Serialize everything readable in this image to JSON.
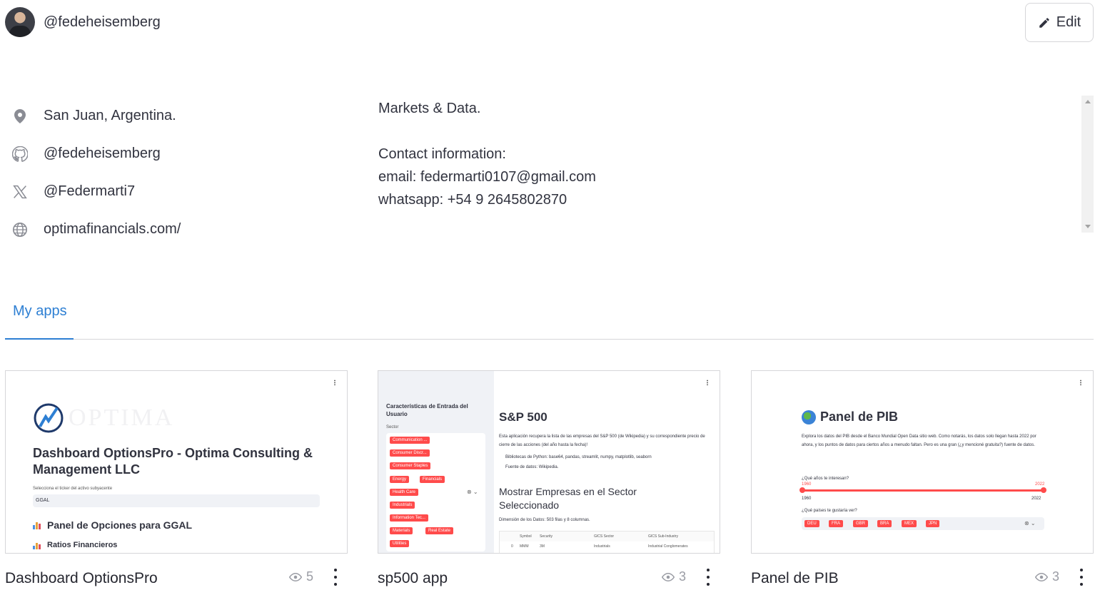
{
  "header": {
    "username": "@fedeheisemberg",
    "edit_label": "Edit"
  },
  "profile": {
    "location": "San Juan, Argentina.",
    "github": "@fedeheisemberg",
    "x": "@Federmarti7",
    "website": "optimafinancials.com/"
  },
  "bio": {
    "lines": [
      "Markets & Data.",
      "",
      "Contact information:",
      "email: federmarti0107@gmail.com",
      "whatsapp: +54 9 2645802870"
    ]
  },
  "tabs": [
    {
      "label": "My apps",
      "active": true
    }
  ],
  "apps": [
    {
      "title": "Dashboard OptionsPro",
      "views": "5",
      "preview": {
        "logo_text": "OPTIMA",
        "title": "Dashboard OptionsPro - Optima Consulting & Management LLC",
        "input_label": "Selecciona el ticker del activo subyacente",
        "input_value": "GGAL",
        "h2": "Panel de Opciones para GGAL",
        "h3": "Ratios Financieros"
      }
    },
    {
      "title": "sp500 app",
      "views": "3",
      "preview": {
        "sidebar_title": "Características de Entrada del Usuario",
        "sidebar_label": "Sector",
        "chips": [
          "Communication ...",
          "Consumer Discr...",
          "Consumer Staples",
          "Energy",
          "Financials",
          "Health Care",
          "Industrials",
          "Information Tec...",
          "Materials",
          "Real Estate",
          "Utilities"
        ],
        "heading": "S&P 500",
        "intro": "Esta aplicación recupera la lista de las empresas del S&P 500 (de Wikipedia) y su correspondiente precio de cierre de las acciones (del año hasta la fecha)!",
        "bullet1": "Bibliotecas de Python: base64, pandas, streamlit, numpy, matplotlib, seaborn",
        "bullet2": "Fuente de datos: Wikipedia.",
        "h2": "Mostrar Empresas en el Sector Seleccionado",
        "dims": "Dimensión de los Datos: 503 filas y 8 columnas.",
        "table_headers": [
          "Symbol",
          "Security",
          "GICS Sector",
          "GICS Sub-Industry"
        ],
        "table_row": [
          "0",
          "MMM",
          "3M",
          "Industrials",
          "Industrial Conglomerates"
        ]
      }
    },
    {
      "title": "Panel de PIB",
      "views": "3",
      "preview": {
        "heading": "Panel de PIB",
        "intro": "Explora los datos del PIB desde el Banco Mundial Open Data sitio web. Como notarás, los datos solo llegan hasta 2022 por ahora, y los puntos de datos para ciertos años a menudo faltan. Pero es una gran (¿y mencioné gratuita?) fuente de datos.",
        "slider_label": "¿Qué años te interesan?",
        "year_start": "1960",
        "year_end": "2022",
        "multi_label": "¿Qué países te gustaría ver?",
        "countries": [
          "DEU",
          "FRA",
          "GBR",
          "BRA",
          "MEX",
          "JPN"
        ]
      }
    }
  ],
  "colors": {
    "accent": "#2d7fd3",
    "chip": "#ff4b4b",
    "text": "#31333f",
    "icon_gray": "#8a8c94"
  },
  "icons": {
    "location": "map-pin-icon",
    "github": "github-icon",
    "x": "x-logo-icon",
    "website": "globe-icon",
    "edit": "pencil-icon",
    "views": "eye-icon",
    "menu": "vertical-dots-icon"
  }
}
